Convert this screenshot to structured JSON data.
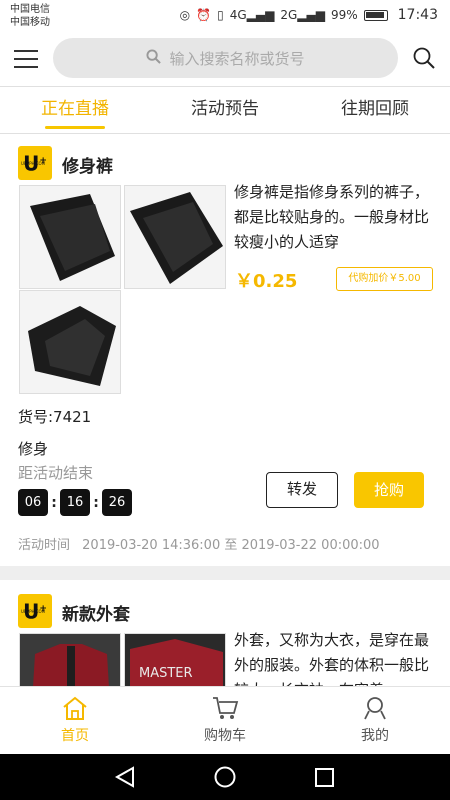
{
  "status_bar": {
    "carrier1": "中国电信",
    "carrier2": "中国移动",
    "signal1": "4G",
    "signal2": "2G",
    "battery": "99%",
    "time": "17:43"
  },
  "search": {
    "placeholder": "输入搜索名称或货号"
  },
  "tabs": [
    {
      "label": "正在直播",
      "active": true
    },
    {
      "label": "活动预告",
      "active": false
    },
    {
      "label": "往期回顾",
      "active": false
    }
  ],
  "products": [
    {
      "title": "修身裤",
      "description": "修身裤是指修身系列的裤子，都是比较贴身的。一般身材比较瘦小的人适穿",
      "price": "￥0.25",
      "agent_price": "代购加价￥5.00",
      "sku": "货号:7421",
      "tag": "修身",
      "countdown_label": "距活动结束",
      "countdown": {
        "hours": "06",
        "minutes": "16",
        "seconds": "26"
      },
      "forward_label": "转发",
      "grab_label": "抢购",
      "time_label": "活动时间",
      "time_range": "2019-03-20 14:36:00 至 2019-03-22 00:00:00"
    },
    {
      "title": "新款外套",
      "description": "外套，又称为大衣，是穿在最外的服装。外套的体积一般比较大，长衣袖，在穿着",
      "image_text": "MASTER"
    }
  ],
  "bottom_nav": [
    {
      "label": "首页",
      "icon": "home-icon",
      "active": true
    },
    {
      "label": "购物车",
      "icon": "cart-icon",
      "active": false
    },
    {
      "label": "我的",
      "icon": "user-icon",
      "active": false
    }
  ],
  "colors": {
    "accent": "#f9c600",
    "price": "#f5b800"
  }
}
